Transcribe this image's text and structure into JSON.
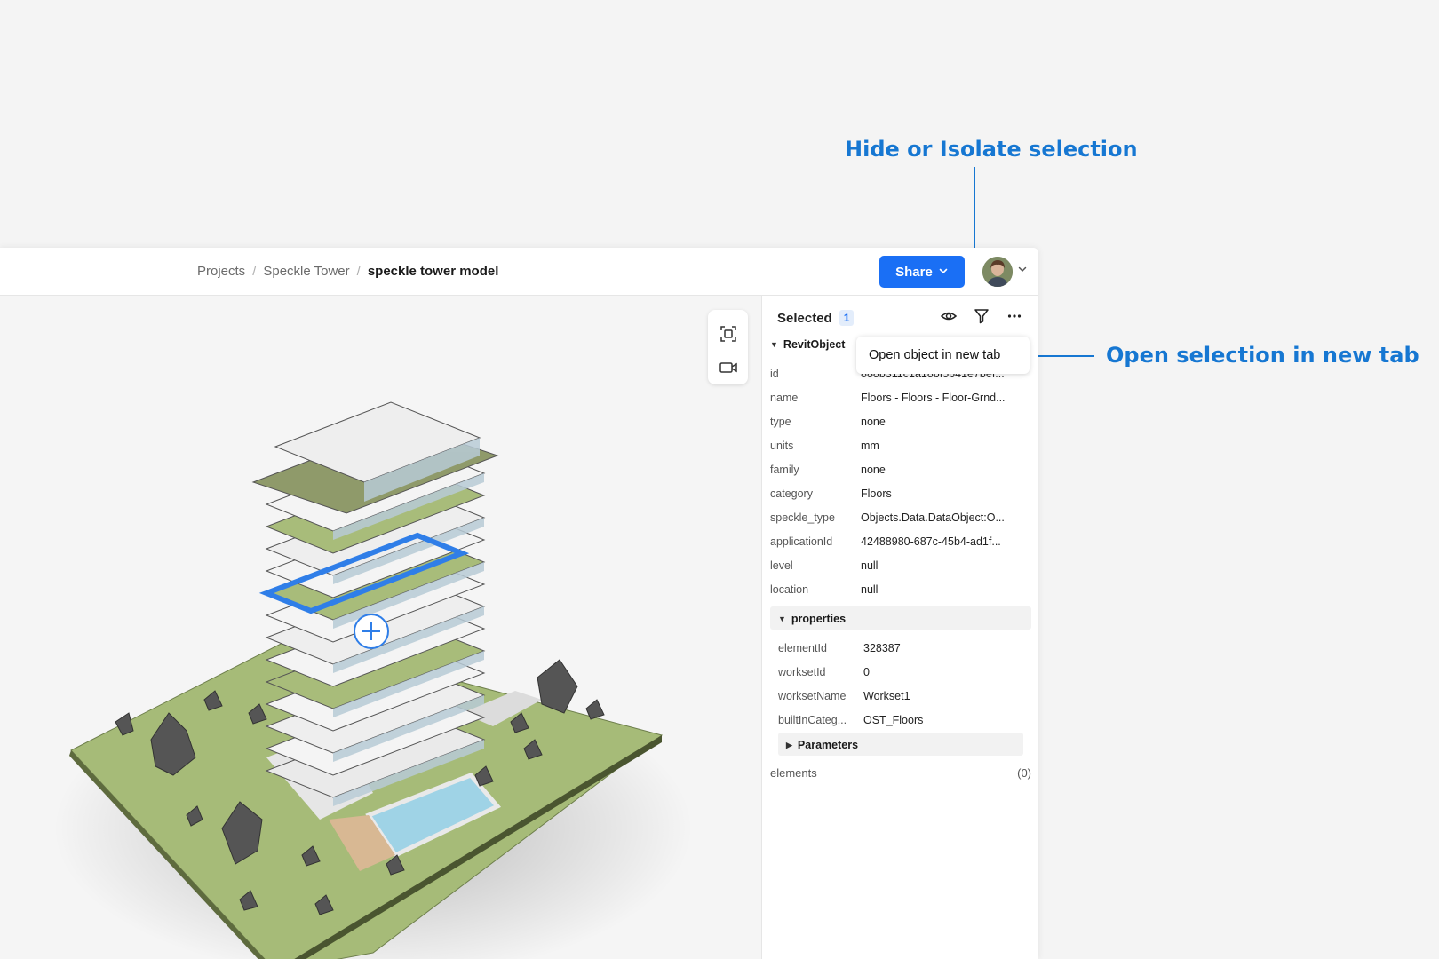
{
  "annotations": {
    "hide_isolate": "Hide or Isolate selection",
    "open_new_tab": "Open selection in new tab"
  },
  "breadcrumb": [
    "Projects",
    "Speckle Tower",
    "speckle tower model"
  ],
  "header": {
    "share_label": "Share"
  },
  "icons": {
    "share_chevron": "chevron-down-icon",
    "avatar_chevron": "chevron-down-icon",
    "zoom_extents": "frame-focus-icon",
    "camera": "video-camera-icon",
    "eye": "eye-icon",
    "filter": "filter-icon",
    "more": "more-horizontal-icon",
    "selection_marker": "plus-circle-icon"
  },
  "panel": {
    "title": "Selected",
    "count": "1",
    "root_label": "RevitObject",
    "tooltip": "Open object in new tab",
    "properties": [
      {
        "key": "id",
        "value": "888b311c1a18bf5b41e7bef..."
      },
      {
        "key": "name",
        "value": "Floors - Floors - Floor-Grnd..."
      },
      {
        "key": "type",
        "value": "none"
      },
      {
        "key": "units",
        "value": "mm"
      },
      {
        "key": "family",
        "value": "none"
      },
      {
        "key": "category",
        "value": "Floors"
      },
      {
        "key": "speckle_type",
        "value": "Objects.Data.DataObject:O..."
      },
      {
        "key": "applicationId",
        "value": "42488980-687c-45b4-ad1f..."
      },
      {
        "key": "level",
        "value": "null"
      },
      {
        "key": "location",
        "value": "null"
      }
    ],
    "sub_label": "properties",
    "sub_properties": [
      {
        "key": "elementId",
        "value": "328387"
      },
      {
        "key": "worksetId",
        "value": "0"
      },
      {
        "key": "worksetName",
        "value": "Workset1"
      },
      {
        "key": "builtInCateg...",
        "value": "OST_Floors"
      }
    ],
    "params_label": "Parameters",
    "elements_label": "elements",
    "elements_count": "(0)"
  },
  "colors": {
    "accent": "#1a6ff5",
    "annotation": "#1677d2",
    "selection": "#2f7ee8",
    "ground": "#a6bb78"
  }
}
